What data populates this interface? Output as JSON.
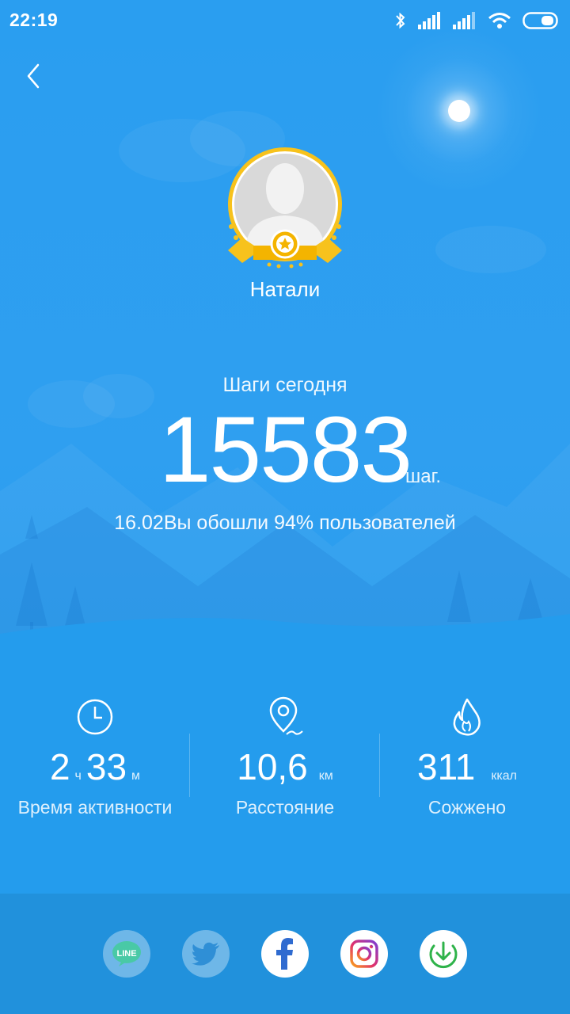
{
  "status": {
    "time": "22:19"
  },
  "user": {
    "name": "Натали"
  },
  "steps": {
    "label": "Шаги сегодня",
    "value": "15583",
    "unit": "шаг.",
    "rank_text": "16.02Вы обошли 94% пользователей"
  },
  "stats": {
    "active": {
      "hours": "2",
      "hours_unit": "ч",
      "minutes": "33",
      "minutes_unit": "м",
      "label": "Время активности"
    },
    "distance": {
      "value": "10,6",
      "unit": "км",
      "label": "Расстояние"
    },
    "calories": {
      "value": "311",
      "unit": "ккал",
      "label": "Сожжено"
    }
  },
  "share": {
    "line_label": "LINE"
  },
  "colors": {
    "accent": "#2a9ef0",
    "badge_gold": "#f7c21c",
    "download_green": "#2fb34a"
  }
}
